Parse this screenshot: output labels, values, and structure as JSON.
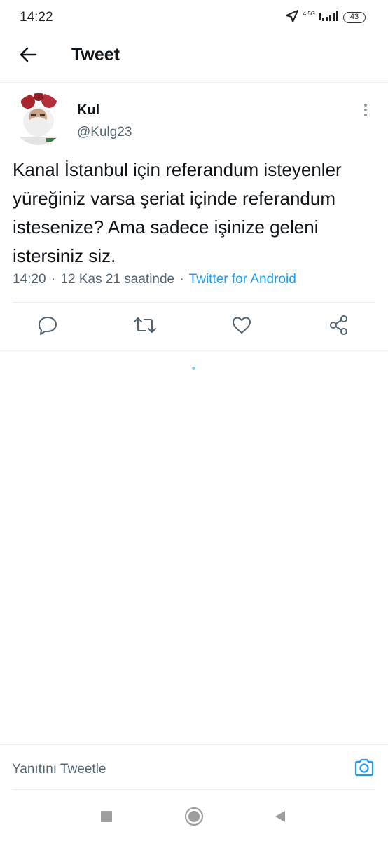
{
  "status_bar": {
    "time": "14:22",
    "network": "4.5G",
    "battery": "43",
    "icons": [
      "location-arrow-icon",
      "signal-icon",
      "battery-icon"
    ]
  },
  "header": {
    "back_icon": "arrow-left-icon",
    "title": "Tweet"
  },
  "tweet": {
    "author_name": "Kul",
    "author_handle": "@Kulg23",
    "text": "Kanal İstanbul için referandum isteyenler yüreğiniz varsa şeriat içinde referandum istesenize? Ama sadece işinize geleni istersiniz siz.",
    "time": "14:20",
    "date": "12 Kas 21 saatinde",
    "source": "Twitter for Android",
    "separator": "·"
  },
  "actions": [
    {
      "name": "reply-icon"
    },
    {
      "name": "retweet-icon"
    },
    {
      "name": "like-icon"
    },
    {
      "name": "share-icon"
    }
  ],
  "reply_bar": {
    "placeholder": "Yanıtını Tweetle",
    "camera_icon": "camera-icon"
  },
  "nav_bar": {
    "icons": [
      "recents-square-icon",
      "home-circle-icon",
      "back-triangle-icon"
    ]
  },
  "colors": {
    "accent": "#1d9bf0",
    "text_primary": "#0f1419",
    "text_secondary": "#536471",
    "divider": "#eceff1"
  }
}
